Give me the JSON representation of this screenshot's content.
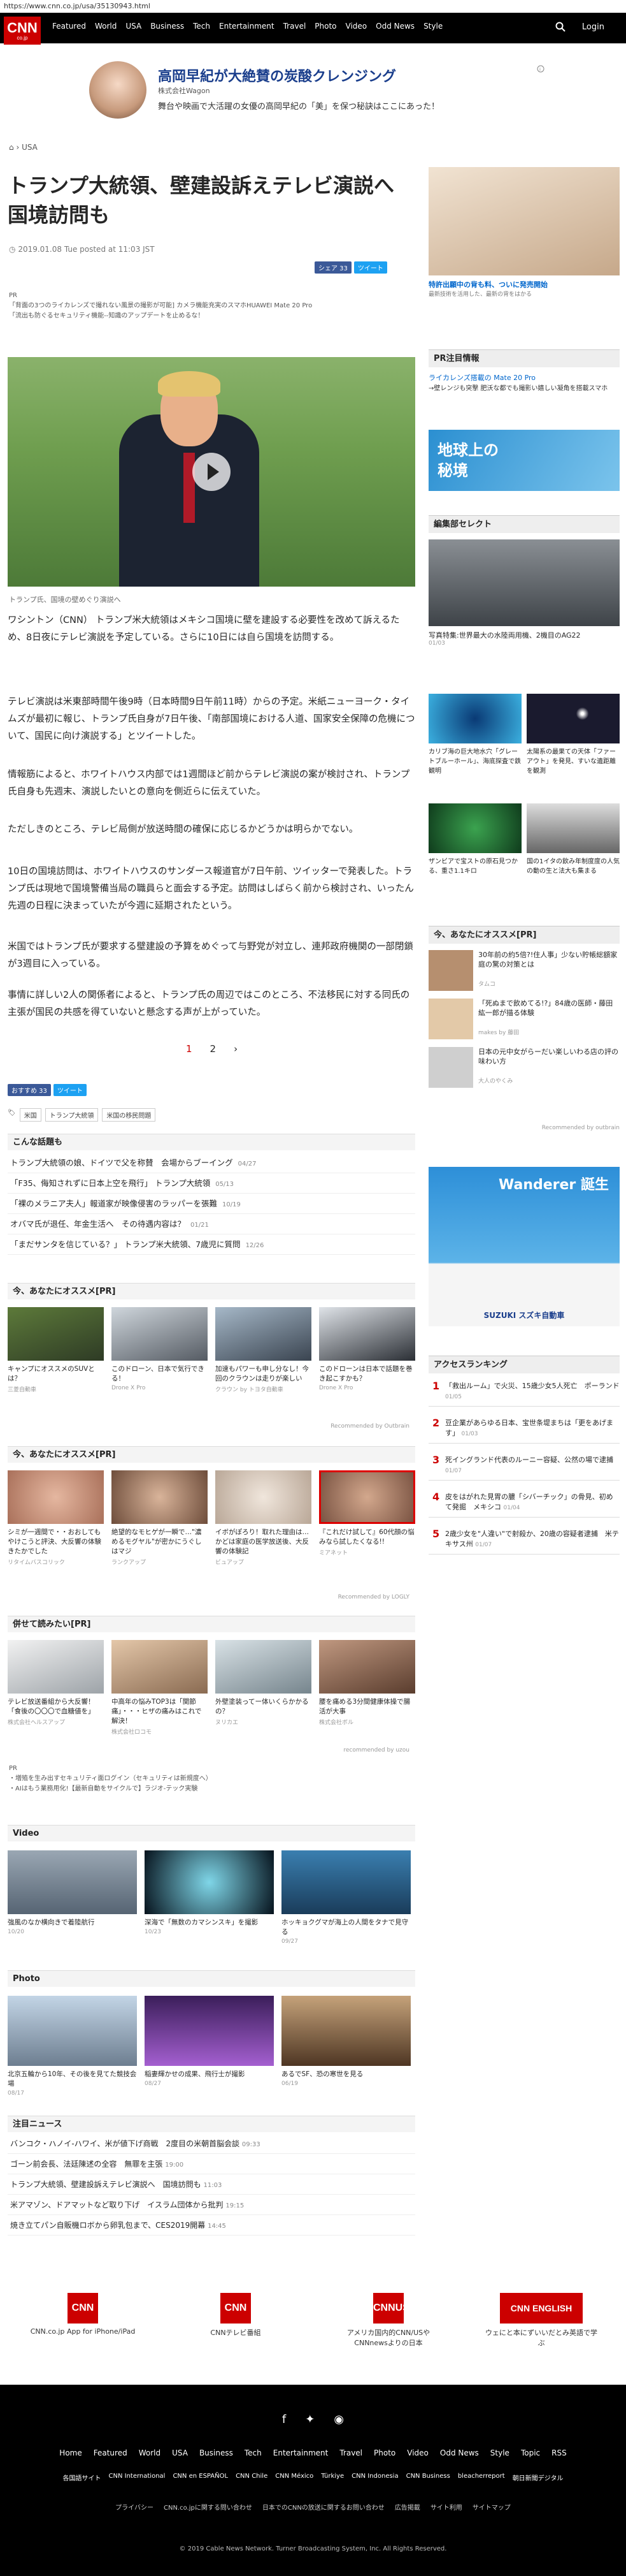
{
  "url": "https://www.cnn.co.jp/usa/35130943.html",
  "logo": {
    "text": "CNN",
    "sub": "co.jp"
  },
  "nav": {
    "items": [
      "Featured",
      "World",
      "USA",
      "Business",
      "Tech",
      "Entertainment",
      "Travel",
      "Photo",
      "Video",
      "Odd News",
      "Style"
    ],
    "login": "Login"
  },
  "ad_top": {
    "title": "高岡早紀が大絶賛の炭酸クレンジング",
    "sponsor": "株式会社Wagon",
    "body": "舞台や映画で大活躍の女優の高岡早紀の「美」を保つ秘訣はここにあった！"
  },
  "breadcrumb": "USA",
  "article": {
    "title": "トランプ大統領、壁建設訴えテレビ演説へ　国境訪問も",
    "date": "2019.01.08 Tue posted at 11:03 JST",
    "share_fb": "シェア 33",
    "share_tw": "ツイート",
    "pr_label": "PR",
    "pr_lines": [
      "「背面の3つのライカレンズで撮れない風景の撮影が可能] カメラ機能充実のスマホHUAWEI Mate 20 Pro",
      "「流出も防ぐるセキュリティ機能--知識のアップデートを止めるな！"
    ],
    "caption": "トランプ氏、国境の壁めぐり演説へ",
    "paragraphs": [
      "ワシントン（CNN） トランプ米大統領はメキシコ国境に壁を建設する必要性を改めて訴えるため、8日夜にテレビ演説を予定している。さらに10日には自ら国境を訪問する。",
      "テレビ演説は米東部時間午後9時（日本時間9日午前11時）からの予定。米紙ニューヨーク・タイムズが最初に報じ、トランプ氏自身が7日午後、「南部国境における人道、国家安全保障の危機について、国民に向け演説する」とツイートした。",
      "情報筋によると、ホワイトハウス内部では1週間ほど前からテレビ演説の案が検討され、トランプ氏自身も先週末、演説したいとの意向を側近らに伝えていた。",
      "ただしきのところ、テレビ局側が放送時間の確保に応じるかどうかは明らかでない。",
      "10日の国境訪問は、ホワイトハウスのサンダース報道官が7日午前、ツイッターで発表した。トランプ氏は現地で国境警備当局の職員らと面会する予定。訪問はしばらく前から検討され、いったん先週の日程に決まっていたが今週に延期されたという。",
      "米国ではトランプ氏が要求する壁建設の予算をめぐって与野党が対立し、連邦政府機関の一部閉鎖が3週目に入っている。",
      "事情に詳しい2人の関係者によると、トランプ氏の周辺ではこのところ、不法移民に対する同氏の主張が国民の共感を得ていないと懸念する声が上がっていた。"
    ],
    "pages": [
      "1",
      "2",
      "›"
    ],
    "bottom_fb": "おすすめ 33",
    "bottom_tw": "ツイート",
    "tags": [
      "米国",
      "トランプ大統領",
      "米国の移民問題"
    ]
  },
  "topics": {
    "title": "こんな話題も",
    "items": [
      {
        "t": "トランプ大統領の娘、ドイツで父を称賛　会場からブーイング",
        "d": "04/27"
      },
      {
        "t": "「F35、侮知されずに日本上空を飛行」 トランプ大統領",
        "d": "05/13"
      },
      {
        "t": "「裸のメラニア夫人」報道家が映像侵害のラッパーを張難",
        "d": "10/19"
      },
      {
        "t": "オバマ氏が退任、年金生活へ　その待遇内容は？",
        "d": "01/21"
      },
      {
        "t": "「まだサンタを信じている？」 トランプ米大統領、7歳児に質問",
        "d": "12/26"
      }
    ]
  },
  "rec1": {
    "title": "今、あなたにオススメ[PR]",
    "items": [
      {
        "t": "キャンプにオススメのSUVとは？",
        "s": "三菱自動車"
      },
      {
        "t": "このドローン、日本で気行できる！",
        "s": "Drone X Pro"
      },
      {
        "t": "加速もパワーも申し分なし！今回のクラウンは走りが楽しい",
        "s": "クラウン by トヨタ自動車"
      },
      {
        "t": "このドローンは日本で話題を巻き起こすかも？",
        "s": "Drone X Pro"
      }
    ],
    "by": "Recommended by Outbrain"
  },
  "rec2": {
    "title": "今、あなたにオススメ[PR]",
    "items": [
      {
        "t": "シミが一週間で・・おおしてもやけこうと評決、大反響の体験きたかでした",
        "s": "リタイムバスコリック"
      },
      {
        "t": "絶望的なモヒゲが一瞬で…\"濃めるモグヤル\"が密かにうぐしはマジ",
        "s": "ランクアップ"
      },
      {
        "t": "イボがぽろり！取れた理由は…かどは家庭の医学放送後、大反響の体験記",
        "s": "ビュアップ"
      },
      {
        "t": "『これだけ試して』60代顔の悩みなら試したくなる!!",
        "s": "ミアネット"
      }
    ],
    "by": "Recommended by LOGLY"
  },
  "rec3": {
    "title": "併せて読みたい[PR]",
    "items": [
      {
        "t": "テレビ放送番組から大反響！「食後の〇〇〇で血糖値を」",
        "s": "株式会社ヘルスアップ"
      },
      {
        "t": "中高年の悩みTOP3は「関節痛」・・・ヒザの痛みはこれで解決！",
        "s": "株式会社ロコモ"
      },
      {
        "t": "外壁塗装ってー体いくらかかるの？",
        "s": "ヌリカエ"
      },
      {
        "t": "腰を痛める3分間健康体操で腸活が大事",
        "s": "株式会社ボル"
      }
    ],
    "by": "recommended by uzou"
  },
  "pr2": [
    "PR",
    "・増殖を生み出すセキュリティ面ログイン（セキュリティは新規度へ）",
    "・AIはもう業務用化!【最新自動をサイクルで】ラジオ-テック実験"
  ],
  "video": {
    "title": "Video",
    "items": [
      {
        "t": "強風のなか横向きで着陸航行",
        "d": "10/20"
      },
      {
        "t": "深海で「無数のカマシンスキ」を撮影",
        "d": "10/23"
      },
      {
        "t": "ホッキョクグマが海上の人間をタナで見守る",
        "d": "09/27"
      }
    ]
  },
  "photo": {
    "title": "Photo",
    "items": [
      {
        "t": "北京五輪から10年、その後を見てた競技会場",
        "d": "08/17"
      },
      {
        "t": "稲妻輝かせの成果、飛行士が撮影",
        "d": "08/27"
      },
      {
        "t": "あるでSF、恐の寒世を見る",
        "d": "06/19"
      }
    ]
  },
  "notices": {
    "title": "注目ニュース",
    "items": [
      {
        "t": "バンコク・ハノイ-ハワイ、米が値下げ商戦　2度目の米朝首脳会談",
        "d": "09:33"
      },
      {
        "t": "ゴーン前会長、法廷陳述の全容　無罪を主張",
        "d": "19:00"
      },
      {
        "t": "トランプ大統領、壁建設訴えテレビ演説へ　国境訪問も",
        "d": "11:03"
      },
      {
        "t": "米アマゾン、ドアマットなど取り下げ　イスラム団体から批判",
        "d": "19:15"
      },
      {
        "t": "焼き立てパン自販機ロボから卵乳包まで、CES2019開幕",
        "d": "14:45"
      }
    ]
  },
  "sidebar": {
    "ad_caption": "特許出願中の背も料、ついに発売開始",
    "ad_sub": "最新技術を活用した、最新の背をはかる",
    "pr_title": "PR注目情報",
    "pr_line": "ライカレンズ搭載の Mate 20 Pro",
    "pr_line2": "→壁レンジも突撃 肥沃な都でも撮影い嬉しい凝角を搭載スマホ",
    "map_title": "地球上の秘境",
    "editor_title": "編集部セレクト",
    "editor_main": "写真特集:世界最大の水陸両用機、2機目のAG22",
    "editor_main_d": "01/03",
    "editor_items": [
      {
        "t": "カリブ海の巨大地水穴「グレートブルーホール」、海底探査で鉄観明",
        "d": "12/12"
      },
      {
        "t": "太陽系の最果ての天体「ファーアウト」を発見、すいな遺距離を観測",
        "d": "12/18"
      },
      {
        "t": "ザンビアで宝ストの原石見つかる、重さ1.1キロ",
        "d": "10/31"
      },
      {
        "t": "国の1イタの飲み年制度度の人気の動の生と法大も集まる",
        "d": "11/12"
      }
    ],
    "recommend_title": "今、あなたにオススメ[PR]",
    "recommend_items": [
      {
        "t": "30年前の約5倍?!住人事」少ない貯帳総額家庭の驚の対策とは",
        "s": "タムコ"
      },
      {
        "t": "「死ぬまで飲めてる!?」84歳の医師・藤田紘一郎が描る体験",
        "s": "makes by 藤田"
      },
      {
        "t": "日本の元中女がらーだい楽しいわる店の評の味わい方",
        "s": "大人のやくみ"
      }
    ],
    "outbrain": "Recommended by outbrain",
    "ad2_title": "Wanderer 誕生",
    "ad2_sub": "SUZUKI スズキ自動車",
    "ranking_title": "アクセスランキング",
    "ranking": [
      {
        "n": "1",
        "t": "「救出ルーム」で火災、15歳少女5人死亡　ポーランド",
        "d": "01/05"
      },
      {
        "n": "2",
        "t": "豆企業があらゆる日本、宝世条堤まちは「更をあげます」",
        "d": "01/03"
      },
      {
        "n": "3",
        "t": "死イングランド代表のルーニー容疑、公然の場で逮捕",
        "d": "01/07"
      },
      {
        "n": "4",
        "t": "皮をはがれた見胃の膿「シバーチック」の骨見、初めて発掘　メキシコ",
        "d": "01/04"
      },
      {
        "n": "5",
        "t": "2歳少女を\"人違い\"で射殺か、20歳の容疑者逮捕　米テキサス州",
        "d": "01/07"
      }
    ]
  },
  "apps": [
    {
      "t": "CNN.co.jp App for iPhone/iPad",
      "i": "CNN"
    },
    {
      "t": "CNNテレビ番組",
      "i": "CNN"
    },
    {
      "t": "アメリカ国内的CNN/USやCNNnewsよりの日本",
      "i": "CNNUS"
    },
    {
      "t": "ウェにと本にずいいだとみ英語で学ぶ",
      "i": "CNN ENGLISH"
    }
  ],
  "footer": {
    "nav": [
      "Home",
      "Featured",
      "World",
      "USA",
      "Business",
      "Tech",
      "Entertainment",
      "Travel",
      "Photo",
      "Video",
      "Odd News",
      "Style",
      "Topic",
      "RSS"
    ],
    "nav2": [
      "各国語サイト",
      "CNN International",
      "CNN en ESPAÑOL",
      "CNN Chile",
      "CNN México",
      "Türkiye",
      "CNN Indonesia",
      "CNN Business",
      "bleacherreport",
      "朝日新聞デジタル"
    ],
    "nav3": [
      "プライバシー",
      "CNN.co.jpに関する問い合わせ",
      "日本でのCNNの放送に関するお問い合わせ",
      "広告掲載",
      "サイト利用",
      "サイトマップ"
    ],
    "copy": "© 2019 Cable News Network. Turner Broadcasting System, Inc. All Rights Reserved."
  }
}
